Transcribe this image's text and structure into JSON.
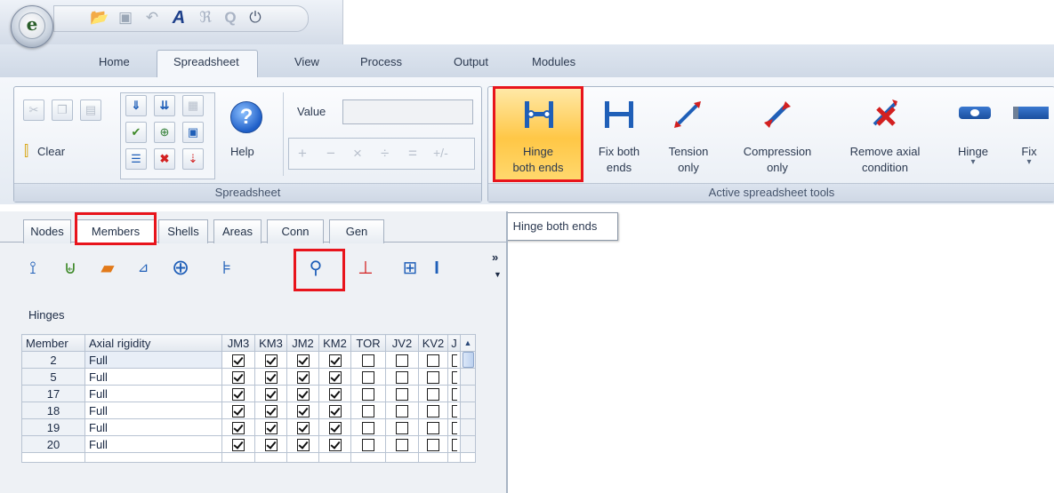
{
  "app": {
    "logo_letter": "e"
  },
  "quick_access": {
    "icons": [
      "open-folder-icon",
      "save-icon",
      "undo-icon",
      "text-a-icon",
      "preview-icon",
      "zoom-icon",
      "power-icon"
    ],
    "glyphs": [
      "📂",
      "▣",
      "↶",
      "A",
      "ℜ",
      "Q",
      "⏻"
    ]
  },
  "ribbon_tabs": [
    "Home",
    "Spreadsheet",
    "View",
    "Process",
    "Output",
    "Modules"
  ],
  "ribbon": {
    "spreadsheet_group": {
      "label": "Spreadsheet",
      "clear_label": "Clear",
      "help_label": "Help",
      "value_label": "Value",
      "value_input": "",
      "ops": [
        "+",
        "−",
        "×",
        "÷",
        "=",
        "+/-"
      ]
    },
    "active_group": {
      "label": "Active spreadsheet tools",
      "buttons": [
        {
          "line1": "Hinge",
          "line2": "both ends"
        },
        {
          "line1": "Fix both",
          "line2": "ends"
        },
        {
          "line1": "Tension",
          "line2": "only"
        },
        {
          "line1": "Compression",
          "line2": "only"
        },
        {
          "line1": "Remove axial",
          "line2": "condition"
        },
        {
          "line1": "Hinge",
          "line2": "▾"
        },
        {
          "line1": "Fix",
          "line2": "▾"
        }
      ]
    }
  },
  "tooltip": "Hinge both ends",
  "panel_tabs": [
    "Nodes",
    "Members",
    "Shells",
    "Areas",
    "Conn",
    "Gen"
  ],
  "toolbar_more": "»",
  "section_title": "Hinges",
  "table": {
    "headers": [
      "Member",
      "Axial rigidity",
      "JM3",
      "KM3",
      "JM2",
      "KM2",
      "TOR",
      "JV2",
      "KV2",
      "J"
    ],
    "rows": [
      {
        "member": "2",
        "axial": "Full"
      },
      {
        "member": "5",
        "axial": "Full"
      },
      {
        "member": "17",
        "axial": "Full"
      },
      {
        "member": "18",
        "axial": "Full"
      },
      {
        "member": "19",
        "axial": "Full"
      },
      {
        "member": "20",
        "axial": "Full"
      }
    ]
  },
  "colors": {
    "highlight_red": "#e8141c",
    "accent_blue": "#1f5fb8"
  }
}
